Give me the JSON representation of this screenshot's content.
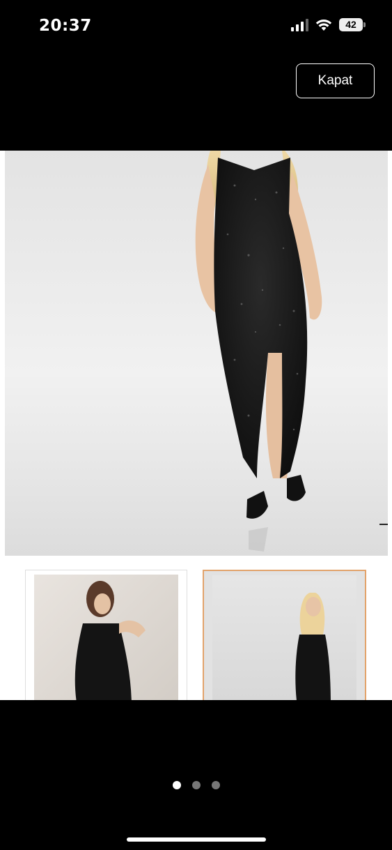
{
  "status_bar": {
    "time": "20:37",
    "battery": "42"
  },
  "header": {
    "close_label": "Kapat"
  },
  "gallery": {
    "page_count": 3,
    "active_page": 1,
    "accent_color": "#e2a36b"
  },
  "icons": [
    "signal-icon",
    "wifi-icon",
    "battery-icon"
  ]
}
